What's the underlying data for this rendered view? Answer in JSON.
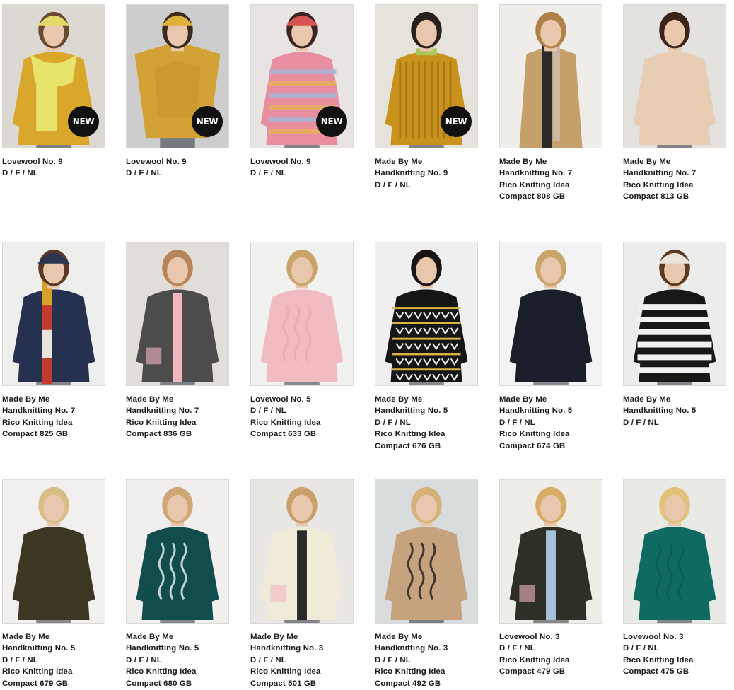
{
  "badge_text": "NEW",
  "rows": [
    [
      {
        "lines": [
          "Lovewool No. 9",
          "D / F / NL"
        ],
        "badge": true,
        "bg": "#dcd9d2",
        "garment": "#d8a72c",
        "accent": "#e6e46a",
        "hair": "#6b4a2f",
        "hat": "#e3d86a",
        "pattern": "scarf"
      },
      {
        "lines": [
          "Lovewool No. 9",
          "D / F / NL"
        ],
        "badge": true,
        "bg": "#cdcdcd",
        "garment": "#d2a236",
        "accent": "#c38f25",
        "hair": "#3b2a20",
        "hat": "#dcb23a",
        "pattern": "poncho"
      },
      {
        "lines": [
          "Lovewool No. 9",
          "D / F / NL"
        ],
        "badge": true,
        "bg": "#e8e4e4",
        "garment": "#e98ea1",
        "accent": "#e7b15a",
        "hair": "#3a2420",
        "hat": "#d95254",
        "pattern": "multi"
      },
      {
        "lines": [
          "Made By Me",
          "Handknitting No. 9",
          "D / F / NL"
        ],
        "badge": true,
        "bg": "#e6e3dc",
        "garment": "#c9921c",
        "accent": "#a9c65b",
        "hair": "#2a211d",
        "hat": "",
        "pattern": "ribbed"
      },
      {
        "lines": [
          "Made By Me",
          "Handknitting No. 7",
          "Rico Knitting Idea",
          "Compact 808 GB"
        ],
        "badge": false,
        "bg": "#efedea",
        "garment": "#c5a06a",
        "accent": "#2a2a2a",
        "hair": "#b0824a",
        "hat": "",
        "pattern": "coat"
      },
      {
        "lines": [
          "Made By Me",
          "Handknitting No. 7",
          "Rico Knitting Idea",
          "Compact 813 GB"
        ],
        "badge": false,
        "bg": "#e4e2df",
        "garment": "#e7cdb4",
        "accent": "#d9bca0",
        "hair": "#3b2519",
        "hat": "",
        "pattern": "plain"
      }
    ],
    [
      {
        "lines": [
          "Made By Me",
          "Handknitting No. 7",
          "Rico Knitting Idea",
          "Compact 825 GB"
        ],
        "badge": false,
        "bg": "#eeeeec",
        "garment": "#26304f",
        "accent": "#d6a22a",
        "hair": "#5a3a26",
        "hat": "#2b3450",
        "pattern": "blocks"
      },
      {
        "lines": [
          "Made By Me",
          "Handknitting No. 7",
          "Rico Knitting Idea",
          "Compact 836 GB"
        ],
        "badge": false,
        "bg": "#e1ded9",
        "garment": "#4c4c4c",
        "accent": "#f1b7bf",
        "hair": "#b6845a",
        "hat": "",
        "pattern": "cardigan"
      },
      {
        "lines": [
          "Lovewool No. 5",
          "D / F / NL",
          "Rico Knitting Idea",
          "Compact 633 GB"
        ],
        "badge": false,
        "bg": "#f1f1f0",
        "garment": "#f0bcc2",
        "accent": "#e8a9b1",
        "hair": "#c9a46a",
        "hat": "",
        "pattern": "cable"
      },
      {
        "lines": [
          "Made By Me",
          "Handknitting No. 5",
          "D / F / NL",
          "Rico Knitting Idea",
          "Compact 676 GB"
        ],
        "badge": false,
        "bg": "#efefef",
        "garment": "#151515",
        "accent": "#d9b344",
        "hair": "#1a1513",
        "hat": "",
        "pattern": "fairisle"
      },
      {
        "lines": [
          "Made By Me",
          "Handknitting No. 5",
          "D / F / NL",
          "Rico Knitting Idea",
          "Compact 674 GB"
        ],
        "badge": false,
        "bg": "#f3f3f3",
        "garment": "#1a1d2a",
        "accent": "#c2463a",
        "hair": "#c9a56b",
        "hat": "",
        "pattern": "plain"
      },
      {
        "lines": [
          "Made By Me",
          "Handknitting No. 5",
          "D / F / NL"
        ],
        "badge": false,
        "bg": "#ececeb",
        "garment": "#181818",
        "accent": "#f2f2f2",
        "hair": "#5b3a22",
        "hat": "#e9e3da",
        "pattern": "stripes"
      }
    ],
    [
      {
        "lines": [
          "Made By Me",
          "Handknitting No. 5",
          "D / F / NL",
          "Rico Knitting Idea",
          "Compact 679 GB"
        ],
        "badge": false,
        "bg": "#f1f0ee",
        "garment": "#3b3722",
        "accent": "#35321f",
        "hair": "#d8bd84",
        "hat": "",
        "pattern": "plain"
      },
      {
        "lines": [
          "Made By Me",
          "Handknitting No. 5",
          "D / F / NL",
          "Rico Knitting Idea",
          "Compact 680 GB"
        ],
        "badge": false,
        "bg": "#f0efee",
        "garment": "#104d4c",
        "accent": "#f4f4f4",
        "hair": "#cfa878",
        "hat": "",
        "pattern": "cable"
      },
      {
        "lines": [
          "Made By Me",
          "Handknitting No. 3",
          "D / F / NL",
          "Rico Knitting Idea",
          "Compact 501 GB"
        ],
        "badge": false,
        "bg": "#e9e7e3",
        "garment": "#f0ead9",
        "accent": "#2a2a2a",
        "hair": "#c7a06a",
        "hat": "",
        "pattern": "cardigan"
      },
      {
        "lines": [
          "Made By Me",
          "Handknitting No. 3",
          "D / F / NL",
          "Rico Knitting Idea",
          "Compact 492 GB"
        ],
        "badge": false,
        "bg": "#d9dcdd",
        "garment": "#c6a27e",
        "accent": "#1d1d1d",
        "hair": "#d7b17a",
        "hat": "",
        "pattern": "cable"
      },
      {
        "lines": [
          "Lovewool No. 3",
          "D / F / NL",
          "Rico Knitting Idea",
          "Compact 479 GB"
        ],
        "badge": false,
        "bg": "#efede8",
        "garment": "#2f2e27",
        "accent": "#a7c3da",
        "hair": "#d7ad63",
        "hat": "",
        "pattern": "cardigan"
      },
      {
        "lines": [
          "Lovewool No. 3",
          "D / F / NL",
          "Rico Knitting Idea",
          "Compact 475 GB"
        ],
        "badge": false,
        "bg": "#e9eae6",
        "garment": "#0f6a62",
        "accent": "#0b5b53",
        "hair": "#e2c27a",
        "hat": "",
        "pattern": "cable"
      }
    ]
  ]
}
